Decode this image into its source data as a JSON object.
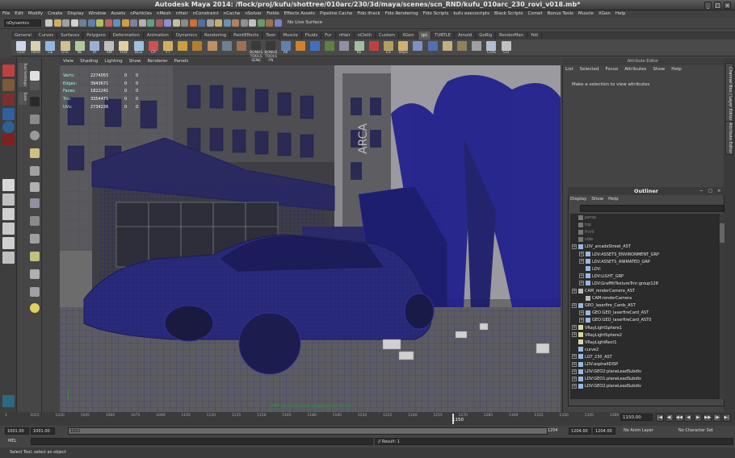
{
  "window": {
    "title": "Autodesk Maya 2014: /flock/proj/kufu/shottree/010arc/230/3d/maya/scenes/scn_RND/kufu_010arc_230_rovi_v018.mb*"
  },
  "menubar": [
    "File",
    "Edit",
    "Modify",
    "Create",
    "Display",
    "Window",
    "Assets",
    "nParticles",
    "nMesh",
    "nHair",
    "nConstraint",
    "nCache",
    "nSolver",
    "Fields",
    "Effects Assets",
    "Pipeline Cache",
    "Fido Ifrack",
    "Fido Rendering",
    "Fido Scripts",
    "kufu execscripts",
    "Black Scripts",
    "Comet",
    "Bonus Tools",
    "Muscle",
    "XGen",
    "Help"
  ],
  "statusline": {
    "mode": "nDynamics",
    "live_surface": "No Live Surface"
  },
  "shelf": {
    "tabs": [
      "General",
      "Curves",
      "Surfaces",
      "Polygons",
      "Deformation",
      "Animation",
      "Dynamics",
      "Rendering",
      "PaintEffects",
      "Toon",
      "Muscle",
      "Fluids",
      "Fur",
      "nHair",
      "nCloth",
      "Custom",
      "XGen",
      "(p)",
      "TURTLE",
      "Arnold",
      "GoRig",
      "RenderMan",
      "Yeti"
    ],
    "active_tab": "(p)",
    "icons": [
      {
        "label": "Outl",
        "color": "#cfd8e8"
      },
      {
        "label": "Hshd",
        "color": "#d8d0b0"
      },
      {
        "label": "GE",
        "color": "#8fb8e0"
      },
      {
        "label": "UTE",
        "color": "#d0c090"
      },
      {
        "label": "NE",
        "color": "#b0c8a0"
      },
      {
        "label": "IA",
        "color": "#9ab0d8"
      },
      {
        "label": "AM",
        "color": "#c0c0c0"
      },
      {
        "label": "Hist",
        "color": "#e0d0a0"
      },
      {
        "label": "DGo",
        "color": "#a0c0e0"
      },
      {
        "label": "CP",
        "color": "#d05050"
      },
      {
        "label": "FT",
        "color": "#d0b060"
      },
      {
        "label": "",
        "color": "#c8a040"
      },
      {
        "label": "",
        "color": "#b08030"
      },
      {
        "label": "",
        "color": "#c09060"
      },
      {
        "label": "",
        "color": "#708090"
      },
      {
        "label": "",
        "color": "#a07050"
      },
      {
        "label": "BONUS TOOLS SENE",
        "color": "#3a3a3a"
      },
      {
        "label": "BONUS TOOLS FN",
        "color": "#3a3a3a"
      },
      {
        "label": "All",
        "color": "#6080b0"
      },
      {
        "label": "",
        "color": "#d08030"
      },
      {
        "label": "",
        "color": "#4070c0"
      },
      {
        "label": "",
        "color": "#608040"
      },
      {
        "label": "",
        "color": "#9090a0"
      },
      {
        "label": "RE",
        "color": "#a0c0a0"
      },
      {
        "label": "",
        "color": "#c04040"
      },
      {
        "label": "ES",
        "color": "#b0a060"
      },
      {
        "label": "Impo",
        "color": "#d0b070"
      },
      {
        "label": "",
        "color": "#8090c0"
      },
      {
        "label": "",
        "color": "#5070b0"
      },
      {
        "label": "",
        "color": "#c0b080"
      },
      {
        "label": "",
        "color": "#908060"
      },
      {
        "label": "",
        "color": "#a0a0a0"
      },
      {
        "label": "COIS",
        "color": "#b0c0d0"
      },
      {
        "label": "CO",
        "color": "#c0c0c0"
      }
    ]
  },
  "viewport": {
    "menu": [
      "View",
      "Shading",
      "Lighting",
      "Show",
      "Renderer",
      "Panels"
    ],
    "hud": [
      {
        "label": "Verts:",
        "v1": "2274055",
        "v2": "0",
        "v3": "0"
      },
      {
        "label": "Edges:",
        "v1": "3943671",
        "v2": "0",
        "v3": "0"
      },
      {
        "label": "Faces:",
        "v1": "1822241",
        "v2": "0",
        "v3": "0"
      },
      {
        "label": "Tris:",
        "v1": "3354471",
        "v2": "0",
        "v3": "0"
      },
      {
        "label": "UVs:",
        "v1": "2734236",
        "v2": "0",
        "v3": "0"
      }
    ],
    "camera_label": "CAM_renderCamera (deployed by rover)",
    "sign_text": "ARCA"
  },
  "attribute_editor": {
    "title": "Attribute Editor",
    "menu": [
      "List",
      "Selected",
      "Focus",
      "Attributes",
      "Show",
      "Help"
    ],
    "message": "Make a selection to view attributes"
  },
  "right_tabs": [
    "Channel Box / Layer Editor",
    "Attribute Editor"
  ],
  "left_tabs": [
    "Tool Settings",
    "Tools"
  ],
  "outliner": {
    "title": "Outliner",
    "menu": [
      "Display",
      "Show",
      "Help"
    ],
    "items": [
      {
        "name": "persp",
        "indent": 1,
        "dim": true,
        "expand": false
      },
      {
        "name": "top",
        "indent": 1,
        "dim": true,
        "expand": false
      },
      {
        "name": "front",
        "indent": 1,
        "dim": true,
        "expand": false
      },
      {
        "name": "side",
        "indent": 1,
        "dim": true,
        "expand": false
      },
      {
        "name": "LDV_arcadeStreet_AST",
        "indent": 1,
        "dim": false,
        "expand": true
      },
      {
        "name": "LDV:ASSETS_ENVIRONMENT_GRP",
        "indent": 2,
        "dim": false,
        "expand": true
      },
      {
        "name": "LDV:ASSETS_ANIMATED_GRP",
        "indent": 2,
        "dim": false,
        "expand": true
      },
      {
        "name": "LDV:",
        "indent": 2,
        "dim": false,
        "expand": false
      },
      {
        "name": "LDV:LIGHT_GRP",
        "indent": 2,
        "dim": false,
        "expand": true
      },
      {
        "name": "LDV:GraffitiTextureTrnr:group128",
        "indent": 2,
        "dim": false,
        "expand": true
      },
      {
        "name": "CAM_renderCamera_AST",
        "indent": 1,
        "dim": false,
        "expand": true
      },
      {
        "name": "CAM:renderCamera",
        "indent": 2,
        "dim": false,
        "expand": false
      },
      {
        "name": "GEO_laserfire_Cards_AST",
        "indent": 1,
        "dim": false,
        "expand": true
      },
      {
        "name": "GEO:GEO_laserfireCard_AST",
        "indent": 2,
        "dim": false,
        "expand": true
      },
      {
        "name": "GEO:GEO_laserfireCard_AST0",
        "indent": 2,
        "dim": false,
        "expand": true
      },
      {
        "name": "VRayLightSphere1",
        "indent": 1,
        "dim": false,
        "expand": true
      },
      {
        "name": "VRayLightSphere2",
        "indent": 1,
        "dim": false,
        "expand": true
      },
      {
        "name": "VRayLightRect1",
        "indent": 1,
        "dim": false,
        "expand": false
      },
      {
        "name": "curve2",
        "indent": 1,
        "dim": false,
        "expand": false
      },
      {
        "name": "LGT_230_AST",
        "indent": 1,
        "dim": false,
        "expand": true
      },
      {
        "name": "LDV:asphaltDISP",
        "indent": 1,
        "dim": false,
        "expand": true
      },
      {
        "name": "LDV:GEO2:planeLeadSubdiv",
        "indent": 1,
        "dim": false,
        "expand": true
      },
      {
        "name": "LDV:GEO1:planeLeadSubdiv",
        "indent": 1,
        "dim": false,
        "expand": true
      },
      {
        "name": "LDV:GEO2:planeLeadSubdiv",
        "indent": 1,
        "dim": false,
        "expand": true
      }
    ]
  },
  "timeline": {
    "ticks": [
      "1",
      "1015",
      "1030",
      "1045",
      "1060",
      "1075",
      "1090",
      "1105",
      "1120",
      "1135",
      "1150",
      "1165",
      "1180",
      "1195",
      "1210",
      "1225",
      "1240",
      "1255",
      "1270",
      "1285",
      "1300",
      "1315",
      "1330",
      "1345",
      "1360"
    ],
    "current_frame": "1150",
    "current_frame_box": "1150.00",
    "playback_buttons": [
      "|◀",
      "◀|",
      "◀◀",
      "◀",
      "▶",
      "▶▶",
      "|▶",
      "▶|"
    ]
  },
  "range": {
    "start": "1001.00",
    "start2": "1001.00",
    "slider_start": "1001",
    "slider_end": "1204",
    "end": "1204.00",
    "end2": "1204.00",
    "anim_layer": "No Anim Layer",
    "char_set": "No Character Set"
  },
  "command": {
    "mel_label": "MEL",
    "result": "// Result: 1"
  },
  "help": {
    "text": "Select Tool: select an object"
  }
}
